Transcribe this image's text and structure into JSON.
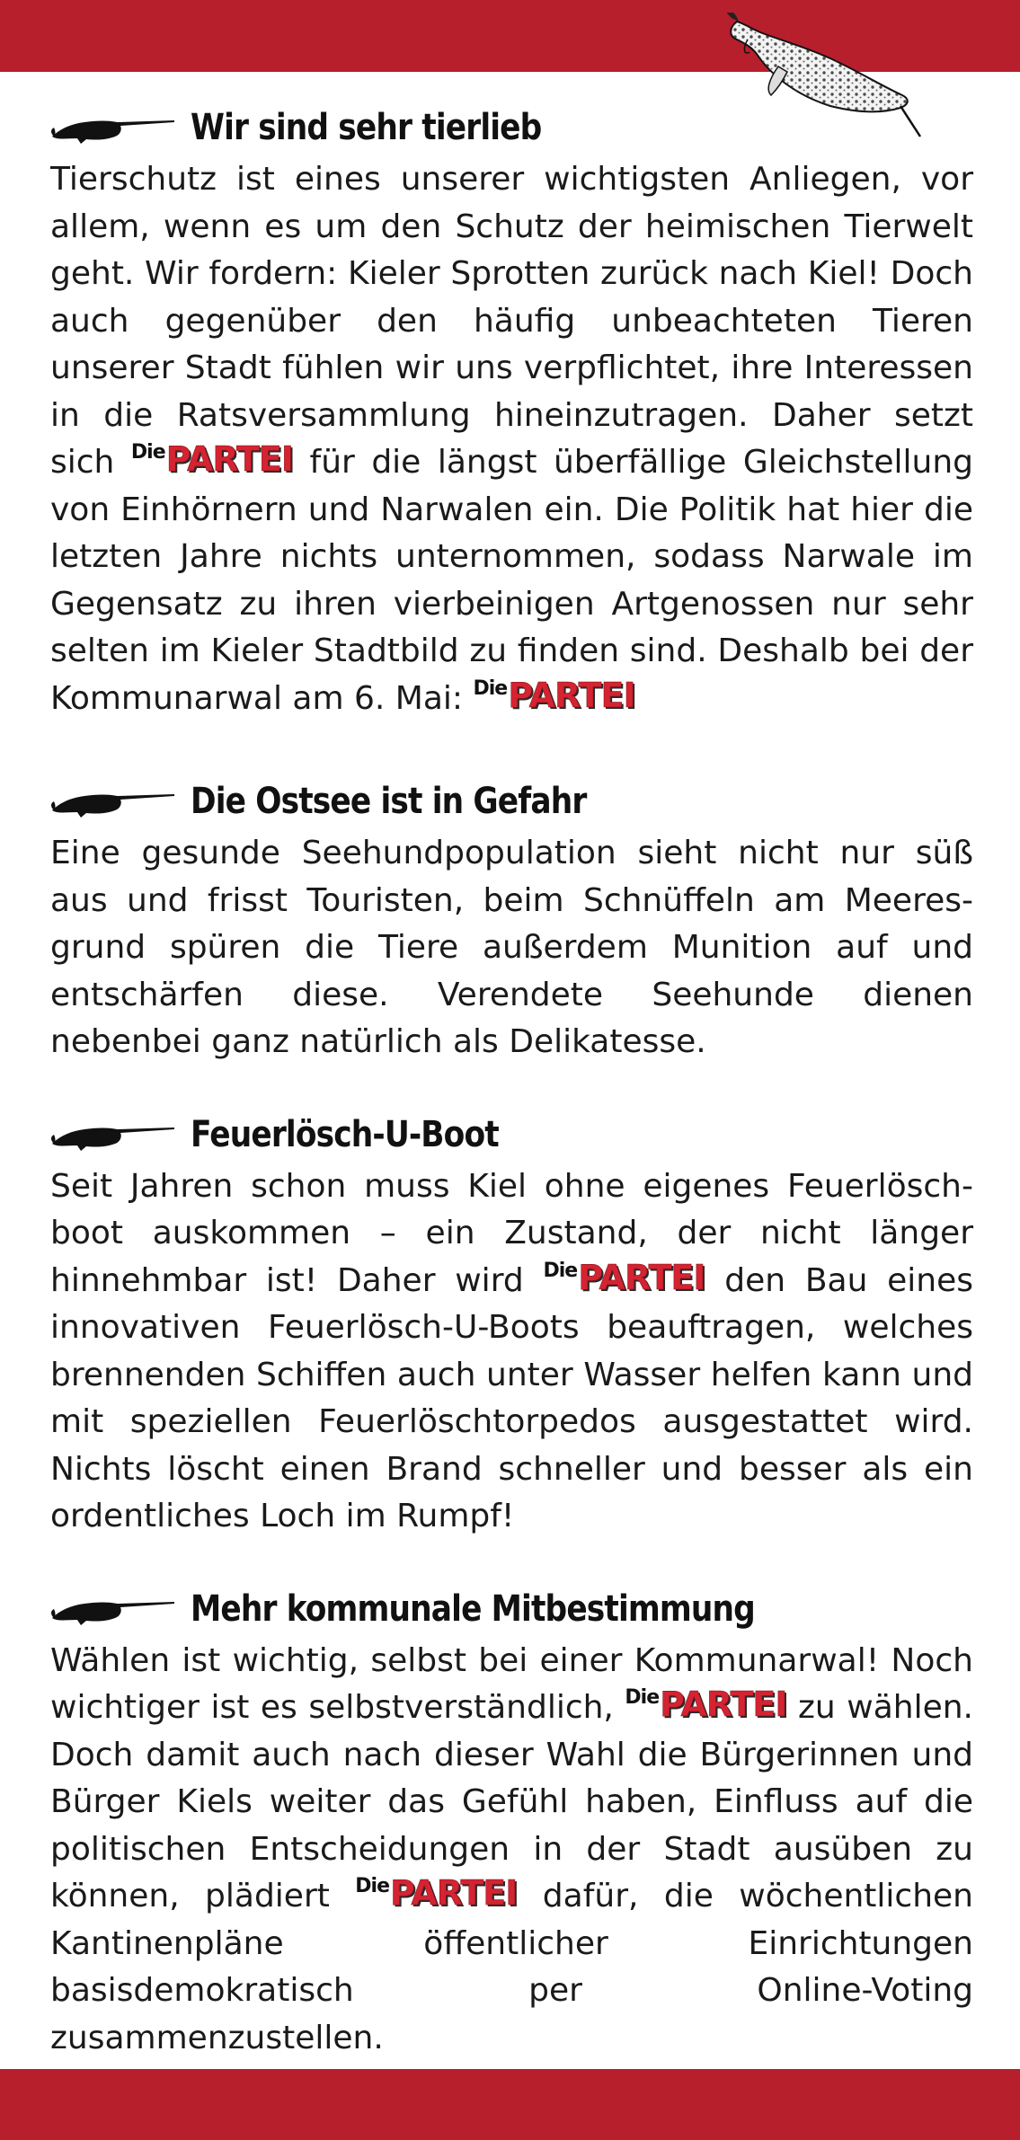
{
  "logo": {
    "die": "Die",
    "partei": "PARTEI"
  },
  "colors": {
    "band": "#b81f2c",
    "logo_red": "#d42331",
    "text": "#1a1a1a"
  },
  "sections": [
    {
      "icon": "narwhal-icon",
      "title": "Wir sind sehr tierlieb",
      "parts": [
        "Tierschutz ist eines unserer wichtigsten Anliegen, vor allem, wenn es um den Schutz der heimischen Tierwelt geht. Wir fordern: Kieler Sprotten zurück nach Kiel! Doch auch gegenüber den häufig unbeachteten Tieren unserer Stadt fühlen wir uns verpflichtet, ihre Interes­sen in die Ratsversammlung hineinzutragen. Daher setzt sich",
        "für die längst überfällige Gleich­stellung von Einhörnern und Narwalen ein. Die Politik hat hier die letzten Jahre nichts unternommen, sodass Narwale im Gegensatz zu ihren vierbeinigen Artgenos­sen nur sehr selten im Kieler Stadtbild zu finden sind. Deshalb bei der Kommunarwal am 6. Mai:",
        ""
      ]
    },
    {
      "icon": "narwhal-icon",
      "title": "Die Ostsee ist in Gefahr",
      "parts": [
        "Eine gesunde Seehundpopulation sieht nicht nur süß aus und frisst Touristen, beim Schnüffeln am Meeres­grund spüren die Tiere außerdem  Munition auf und entschärfen diese. Verendete Seehunde dienen nebenbei ganz natürlich als Delikatesse."
      ]
    },
    {
      "icon": "narwhal-icon",
      "title": "Feuerlösch-U-Boot",
      "parts": [
        "Seit Jahren schon muss Kiel ohne eigenes Feuerlösch­boot auskommen – ein Zustand, der nicht länger hinnehmbar ist! Daher wird",
        "den Bau eines innovativen Feuerlösch-U-Boots beauftragen, welches brennenden Schiffen auch unter Wasser helfen kann und mit speziellen Feuerlöschtorpedos ausgestattet wird. Nichts löscht einen Brand schneller und besser als ein ordentliches Loch im Rumpf!"
      ]
    },
    {
      "icon": "narwhal-icon",
      "title": "Mehr kommunale Mitbestimmung",
      "parts": [
        "Wählen ist wichtig, selbst bei einer Kommunarwal! Noch wichtiger ist es selbstverständlich,",
        "zu wählen. Doch damit auch nach dieser Wahl die Bürgerinnen und Bürger Kiels weiter das Gefühl haben, Einfluss auf die politischen Entscheidungen in der Stadt ausüben zu können, plädiert",
        "dafür, die wöchentlichen Kantinenpläne öffentlicher Einrichtungen basisdemokratisch per Online-Voting zusammenzustellen."
      ]
    }
  ]
}
